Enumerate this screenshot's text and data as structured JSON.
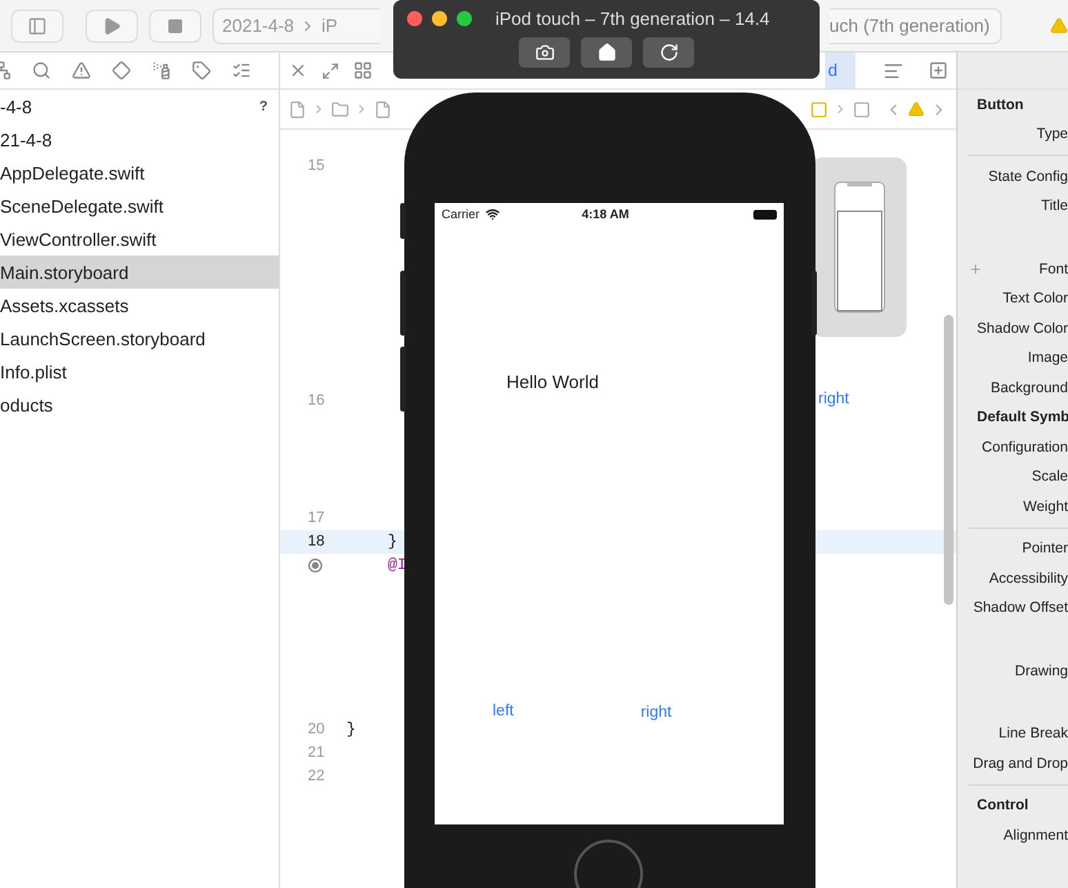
{
  "toolbar": {
    "scheme": "2021-4-8",
    "device": "iP",
    "destination": "uch (7th generation)"
  },
  "navigator": {
    "items": [
      {
        "label": "-4-8",
        "badge": "?",
        "selected": false
      },
      {
        "label": "21-4-8",
        "selected": false
      },
      {
        "label": "AppDelegate.swift",
        "selected": false
      },
      {
        "label": "SceneDelegate.swift",
        "selected": false
      },
      {
        "label": "ViewController.swift",
        "selected": false
      },
      {
        "label": "Main.storyboard",
        "selected": true
      },
      {
        "label": "Assets.xcassets",
        "selected": false
      },
      {
        "label": "LaunchScreen.storyboard",
        "selected": false
      },
      {
        "label": "Info.plist",
        "selected": false
      },
      {
        "label": "oducts",
        "selected": false
      }
    ]
  },
  "editor": {
    "tab": {
      "label": "d",
      "selected": true
    },
    "lines": [
      {
        "kind": "number",
        "number": "15",
        "current": false
      },
      {
        "kind": "number",
        "number": "16",
        "current": false
      },
      {
        "kind": "number",
        "number": "17",
        "current": false
      },
      {
        "kind": "number",
        "number": "18",
        "code": "}",
        "current": true
      },
      {
        "kind": "outlet",
        "code": "@I",
        "current": false
      },
      {
        "kind": "number",
        "number": "20",
        "code": "}",
        "current": false
      },
      {
        "kind": "number",
        "number": "21",
        "current": false
      },
      {
        "kind": "number",
        "number": "22",
        "current": false
      }
    ],
    "canvas_label": "right"
  },
  "inspector": {
    "rows": [
      {
        "kind": "heading",
        "text": "Button"
      },
      {
        "kind": "label",
        "text": "Type"
      },
      {
        "kind": "divider"
      },
      {
        "kind": "label",
        "text": "State Config"
      },
      {
        "kind": "label",
        "text": "Title"
      },
      {
        "kind": "gap"
      },
      {
        "kind": "label",
        "text": "Font",
        "plus": true
      },
      {
        "kind": "label",
        "text": "Text Color"
      },
      {
        "kind": "label",
        "text": "Shadow Color"
      },
      {
        "kind": "label",
        "text": "Image"
      },
      {
        "kind": "label",
        "text": "Background"
      },
      {
        "kind": "heading",
        "text": "Default Symb"
      },
      {
        "kind": "label",
        "text": "Configuration"
      },
      {
        "kind": "label",
        "text": "Scale"
      },
      {
        "kind": "label",
        "text": "Weight"
      },
      {
        "kind": "divider"
      },
      {
        "kind": "label",
        "text": "Pointer"
      },
      {
        "kind": "label",
        "text": "Accessibility"
      },
      {
        "kind": "label",
        "text": "Shadow Offset"
      },
      {
        "kind": "gap"
      },
      {
        "kind": "label",
        "text": "Drawing"
      },
      {
        "kind": "gap"
      },
      {
        "kind": "label",
        "text": "Line Break"
      },
      {
        "kind": "label",
        "text": "Drag and Drop"
      },
      {
        "kind": "divider"
      },
      {
        "kind": "heading",
        "text": "Control"
      },
      {
        "kind": "label",
        "text": "Alignment"
      }
    ]
  },
  "simulator": {
    "title": "iPod touch – 7th generation – 14.4",
    "status": {
      "carrier": "Carrier",
      "time": "4:18 AM"
    },
    "screen": {
      "label": "Hello World",
      "buttons": [
        "left",
        "right"
      ]
    }
  }
}
